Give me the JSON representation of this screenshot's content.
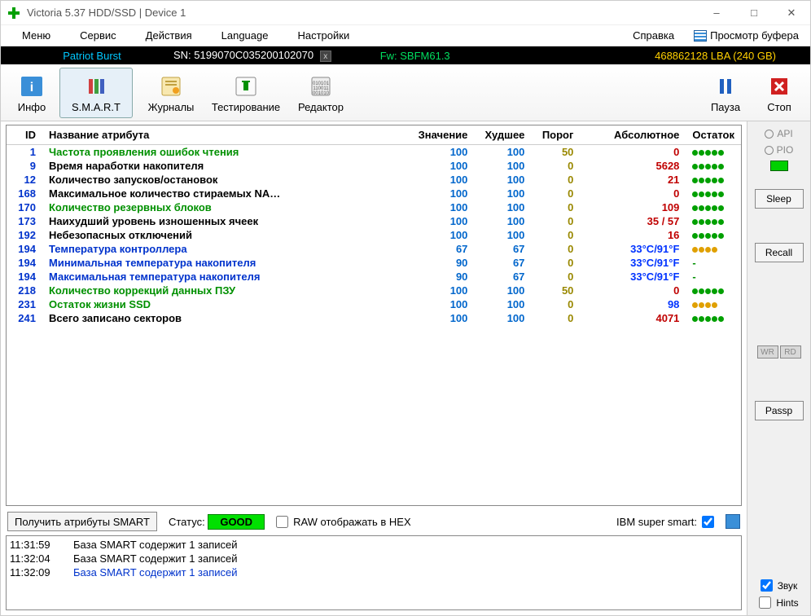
{
  "window": {
    "title": "Victoria 5.37 HDD/SSD | Device 1"
  },
  "menu": {
    "items": [
      "Меню",
      "Сервис",
      "Действия",
      "Language",
      "Настройки",
      "Справка"
    ],
    "view_buffer": "Просмотр буфера"
  },
  "info": {
    "device": "Patriot Burst",
    "sn_label": "SN: ",
    "sn": "5199070C035200102070",
    "fw_label": "Fw: ",
    "fw": "SBFM61.3",
    "lba": "468862128 LBA (240 GB)"
  },
  "toolbar": {
    "info": "Инфо",
    "smart": "S.M.A.R.T",
    "journals": "Журналы",
    "testing": "Тестирование",
    "editor": "Редактор",
    "pause": "Пауза",
    "stop": "Стоп"
  },
  "smart": {
    "headers": {
      "id": "ID",
      "name": "Название атрибута",
      "value": "Значение",
      "worst": "Худшее",
      "thresh": "Порог",
      "abs": "Абсолютное",
      "remain": "Остаток"
    },
    "rows": [
      {
        "id": "1",
        "name": "Частота проявления ошибок чтения",
        "ncol": "green",
        "val": "100",
        "worst": "100",
        "thr": "50",
        "abs": "0",
        "acol": "red",
        "rem": "g5"
      },
      {
        "id": "9",
        "name": "Время наработки накопителя",
        "ncol": "black",
        "val": "100",
        "worst": "100",
        "thr": "0",
        "abs": "5628",
        "acol": "red",
        "rem": "g5"
      },
      {
        "id": "12",
        "name": "Количество запусков/остановок",
        "ncol": "black",
        "val": "100",
        "worst": "100",
        "thr": "0",
        "abs": "21",
        "acol": "red",
        "rem": "g5"
      },
      {
        "id": "168",
        "name": "Максимальное количество стираемых NA…",
        "ncol": "black",
        "val": "100",
        "worst": "100",
        "thr": "0",
        "abs": "0",
        "acol": "red",
        "rem": "g5"
      },
      {
        "id": "170",
        "name": "Количество резервных блоков",
        "ncol": "green",
        "val": "100",
        "worst": "100",
        "thr": "0",
        "abs": "109",
        "acol": "red",
        "rem": "g5"
      },
      {
        "id": "173",
        "name": "Наихудший уровень изношенных ячеек",
        "ncol": "black",
        "val": "100",
        "worst": "100",
        "thr": "0",
        "abs": "35 / 57",
        "acol": "red",
        "rem": "g5"
      },
      {
        "id": "192",
        "name": "Небезопасных отключений",
        "ncol": "black",
        "val": "100",
        "worst": "100",
        "thr": "0",
        "abs": "16",
        "acol": "red",
        "rem": "g5"
      },
      {
        "id": "194",
        "name": "Температура контроллера",
        "ncol": "blue",
        "val": "67",
        "worst": "67",
        "thr": "0",
        "abs": "33°C/91°F",
        "acol": "blue",
        "rem": "o4"
      },
      {
        "id": "194",
        "name": "Минимальная температура накопителя",
        "ncol": "blue",
        "val": "90",
        "worst": "67",
        "thr": "0",
        "abs": "33°C/91°F",
        "acol": "blue",
        "rem": "dash"
      },
      {
        "id": "194",
        "name": "Максимальная температура накопителя",
        "ncol": "blue",
        "val": "90",
        "worst": "67",
        "thr": "0",
        "abs": "33°C/91°F",
        "acol": "blue",
        "rem": "dash"
      },
      {
        "id": "218",
        "name": "Количество коррекций данных ПЗУ",
        "ncol": "green",
        "val": "100",
        "worst": "100",
        "thr": "50",
        "abs": "0",
        "acol": "red",
        "rem": "g5"
      },
      {
        "id": "231",
        "name": "Остаток жизни SSD",
        "ncol": "green",
        "val": "100",
        "worst": "100",
        "thr": "0",
        "abs": "98",
        "acol": "blue",
        "rem": "o4"
      },
      {
        "id": "241",
        "name": "Всего записано секторов",
        "ncol": "black",
        "val": "100",
        "worst": "100",
        "thr": "0",
        "abs": "4071",
        "acol": "red",
        "rem": "g5"
      }
    ]
  },
  "controls": {
    "get_smart": "Получить атрибуты SMART",
    "status_label": "Статус:",
    "status_value": "GOOD",
    "raw_hex": "RAW отображать в HEX",
    "ibm": "IBM super smart:"
  },
  "right": {
    "api": "API",
    "pio": "PIO",
    "sleep": "Sleep",
    "recall": "Recall",
    "wr": "WR",
    "rd": "RD",
    "passp": "Passp",
    "sound": "Звук",
    "hints": "Hints"
  },
  "log": [
    {
      "t": "11:31:59",
      "m": "База SMART содержит 1 записей",
      "c": ""
    },
    {
      "t": "11:32:04",
      "m": "База SMART содержит 1 записей",
      "c": ""
    },
    {
      "t": "11:32:09",
      "m": "База SMART содержит 1 записей",
      "c": "blue"
    }
  ]
}
